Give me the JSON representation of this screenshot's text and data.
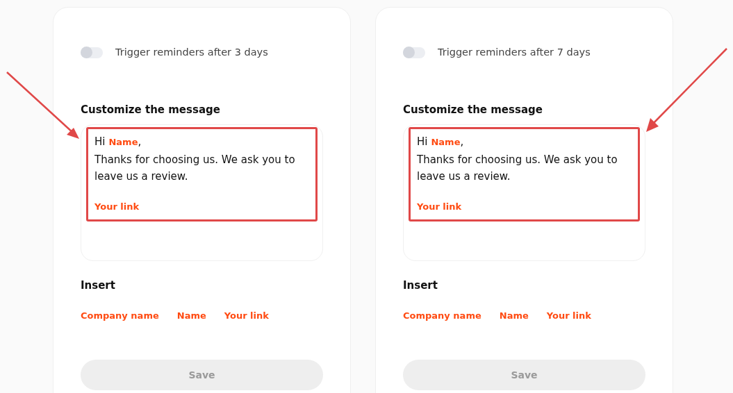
{
  "cards": [
    {
      "toggle": {
        "label": "Trigger reminders after 3 days",
        "on": false
      },
      "heading": "Customize the message",
      "message": {
        "greeting": [
          {
            "kind": "text",
            "text": "Hi"
          },
          {
            "kind": "token",
            "text": "Name"
          },
          {
            "kind": "text",
            "text": ","
          }
        ],
        "body": "Thanks for choosing us. We ask you to leave us a review.",
        "link": "Your link",
        "highlighted": true
      },
      "insert_heading": "Insert",
      "insert_tokens": [
        "Company name",
        "Name",
        "Your link"
      ],
      "save": {
        "label": "Save",
        "disabled": true
      },
      "arrow": true
    },
    {
      "toggle": {
        "label": "Trigger reminders after 7 days",
        "on": false
      },
      "heading": "Customize the message",
      "message": {
        "greeting": [
          {
            "kind": "text",
            "text": "Hi"
          },
          {
            "kind": "token",
            "text": "Name"
          },
          {
            "kind": "text",
            "text": ","
          }
        ],
        "body": "Thanks for choosing us. We ask you to leave us a review.",
        "link": "Your link",
        "highlighted": true
      },
      "insert_heading": "Insert",
      "insert_tokens": [
        "Company name",
        "Name",
        "Your link"
      ],
      "save": {
        "label": "Save",
        "disabled": true
      },
      "arrow": true
    }
  ]
}
